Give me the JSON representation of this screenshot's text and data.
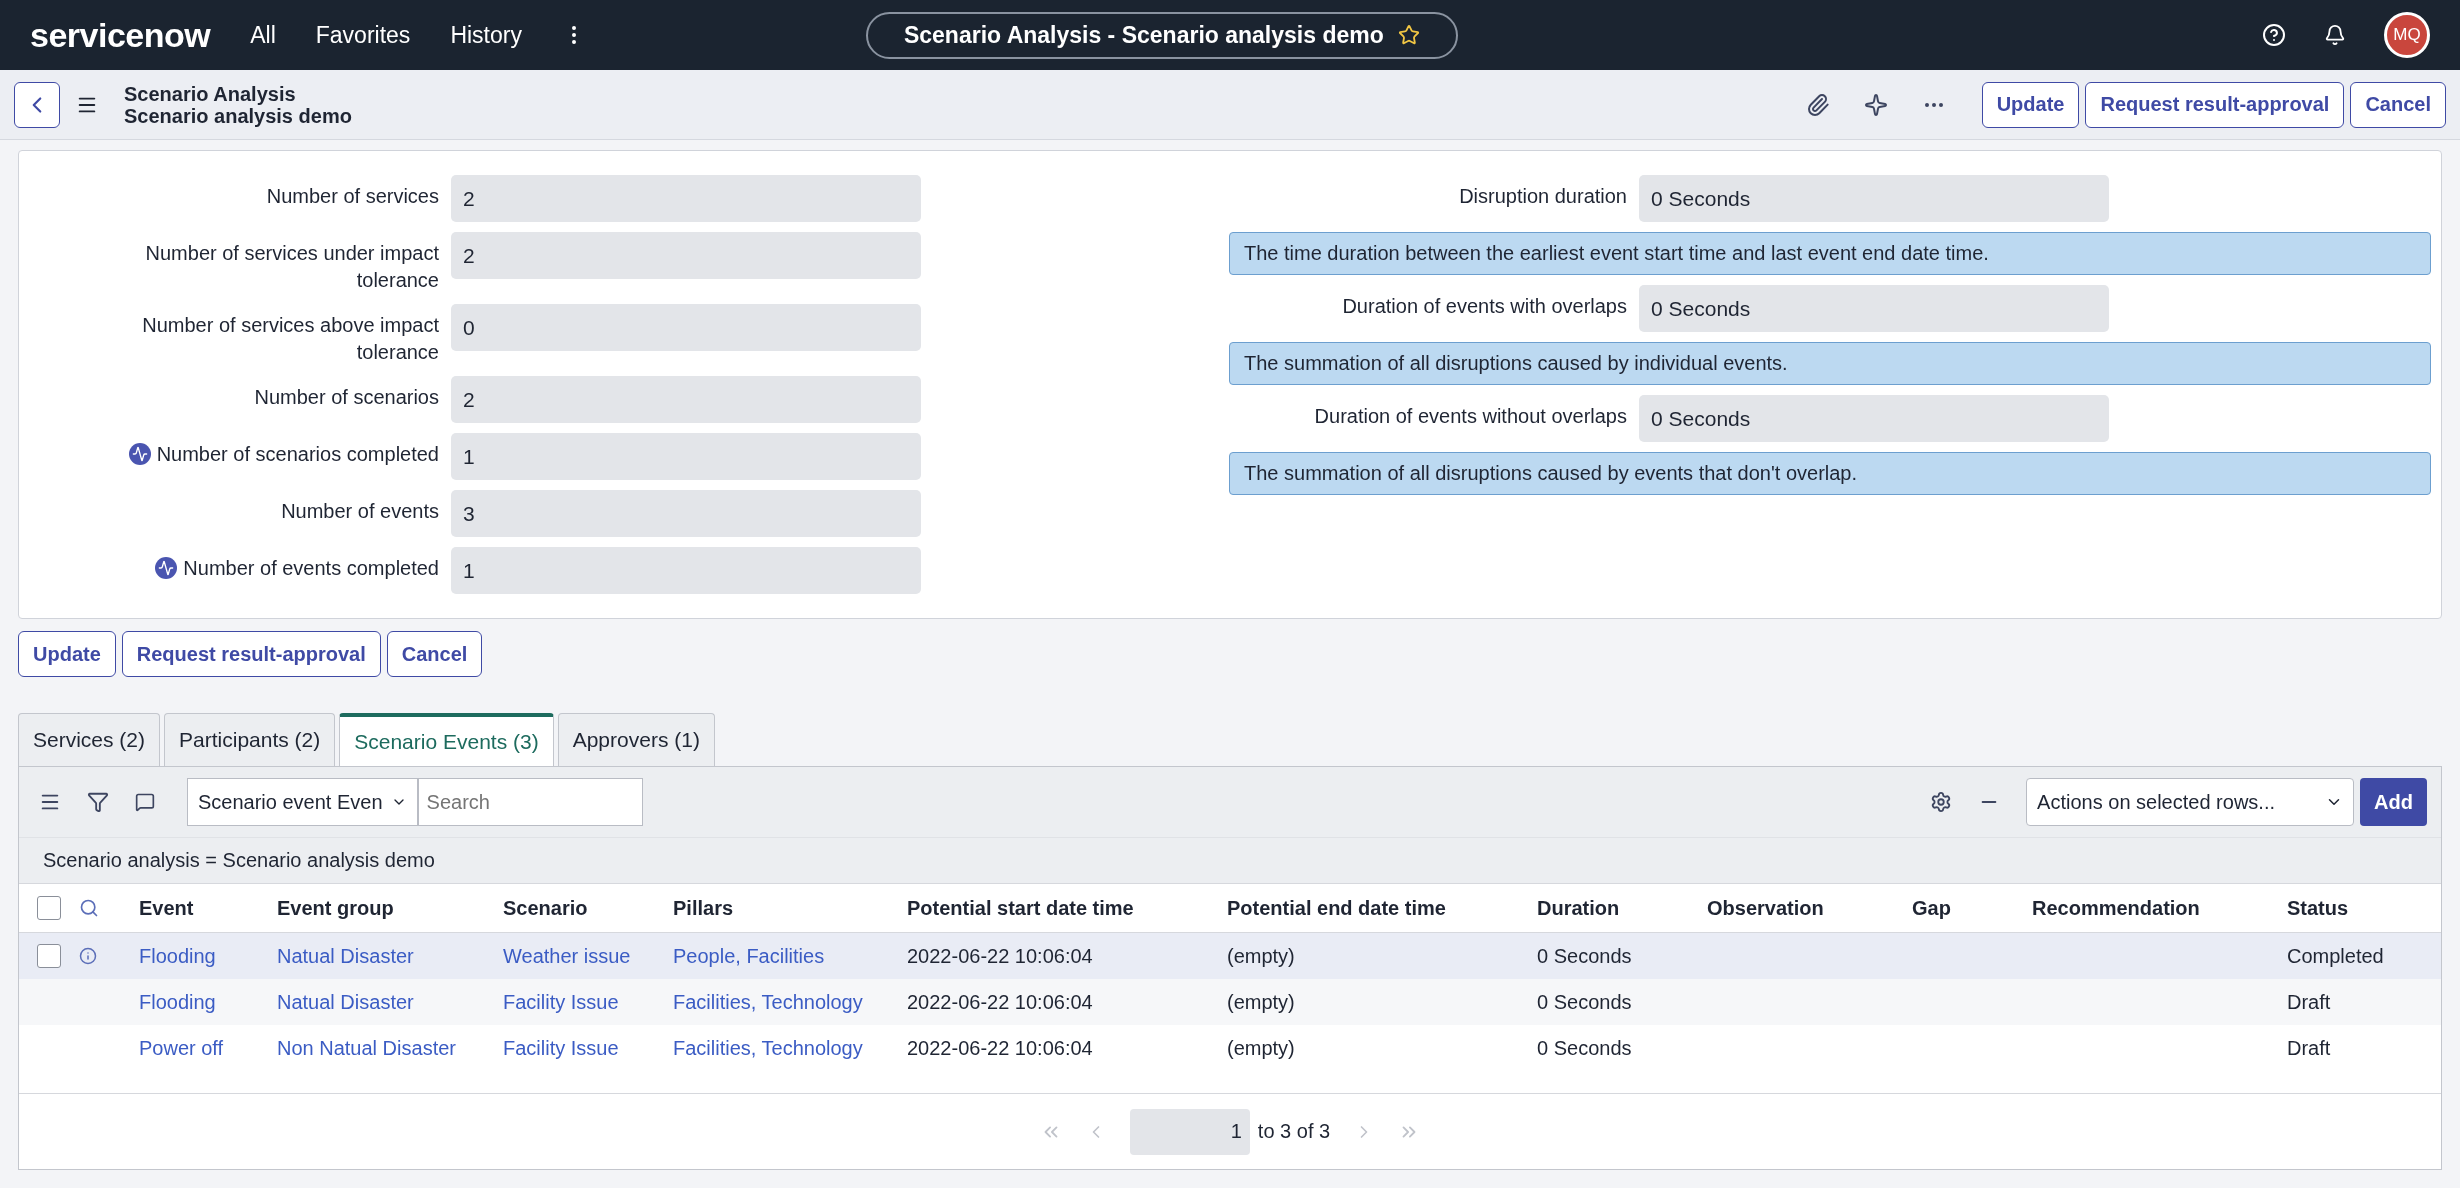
{
  "top_bar": {
    "logo": "servicenow",
    "nav": [
      "All",
      "Favorites",
      "History"
    ],
    "title": "Scenario Analysis - Scenario analysis demo",
    "favorite": false,
    "avatar": "MQ"
  },
  "header": {
    "title": "Scenario Analysis",
    "subtitle": "Scenario analysis demo",
    "buttons": [
      "Update",
      "Request result-approval",
      "Cancel"
    ]
  },
  "form": {
    "left_fields": [
      {
        "label": "Number of services",
        "value": "2",
        "has_icon": false
      },
      {
        "label": "Number of services under impact tolerance",
        "value": "2",
        "has_icon": false
      },
      {
        "label": "Number of services above impact tolerance",
        "value": "0",
        "has_icon": false
      },
      {
        "label": "Number of scenarios",
        "value": "2",
        "has_icon": false
      },
      {
        "label": "Number of scenarios completed",
        "value": "1",
        "has_icon": true
      },
      {
        "label": "Number of events",
        "value": "3",
        "has_icon": false
      },
      {
        "label": "Number of events completed",
        "value": "1",
        "has_icon": true
      }
    ],
    "right_fields": [
      {
        "label": "Disruption duration",
        "value": "0 Seconds",
        "info": "The time duration between the earliest event start time and last event end date time."
      },
      {
        "label": "Duration of events with overlaps",
        "value": "0 Seconds",
        "info": "The summation of all disruptions caused by individual events."
      },
      {
        "label": "Duration of events without overlaps",
        "value": "0 Seconds",
        "info": "The summation of all disruptions caused by events that don't overlap."
      }
    ]
  },
  "form_buttons": [
    "Update",
    "Request result-approval",
    "Cancel"
  ],
  "related_tabs": [
    {
      "label": "Services (2)",
      "selected": false
    },
    {
      "label": "Participants (2)",
      "selected": false
    },
    {
      "label": "Scenario Events (3)",
      "selected": true
    },
    {
      "label": "Approvers (1)",
      "selected": false
    }
  ],
  "list": {
    "search_select": "Scenario event Even",
    "search_placeholder": "Search",
    "actions": "Actions on selected rows...",
    "add_button": "Add",
    "breadcrumb": "Scenario analysis = Scenario analysis demo",
    "all_selected": false,
    "columns": [
      "Event",
      "Event group",
      "Scenario",
      "Pillars",
      "Potential start date time",
      "Potential end date time",
      "Duration",
      "Observation",
      "Gap",
      "Recommendation",
      "Status"
    ],
    "rows": [
      {
        "hovered": true,
        "checked": false,
        "cells": [
          "Flooding",
          "Natual Disaster",
          "Weather issue",
          "People, Facilities",
          "2022-06-22 10:06:04",
          "(empty)",
          "0 Seconds",
          "",
          "",
          "",
          "Completed"
        ]
      },
      {
        "hovered": false,
        "cells": [
          "Flooding",
          "Natual Disaster",
          "Facility Issue",
          "Facilities, Technology",
          "2022-06-22 10:06:04",
          "(empty)",
          "0 Seconds",
          "",
          "",
          "",
          "Draft"
        ]
      },
      {
        "hovered": false,
        "cells": [
          "Power off",
          "Non Natual Disaster",
          "Facility Issue",
          "Facilities, Technology",
          "2022-06-22 10:06:04",
          "(empty)",
          "0 Seconds",
          "",
          "",
          "",
          "Draft"
        ]
      }
    ],
    "pagination": {
      "page": "1",
      "range": "to 3 of 3"
    }
  }
}
